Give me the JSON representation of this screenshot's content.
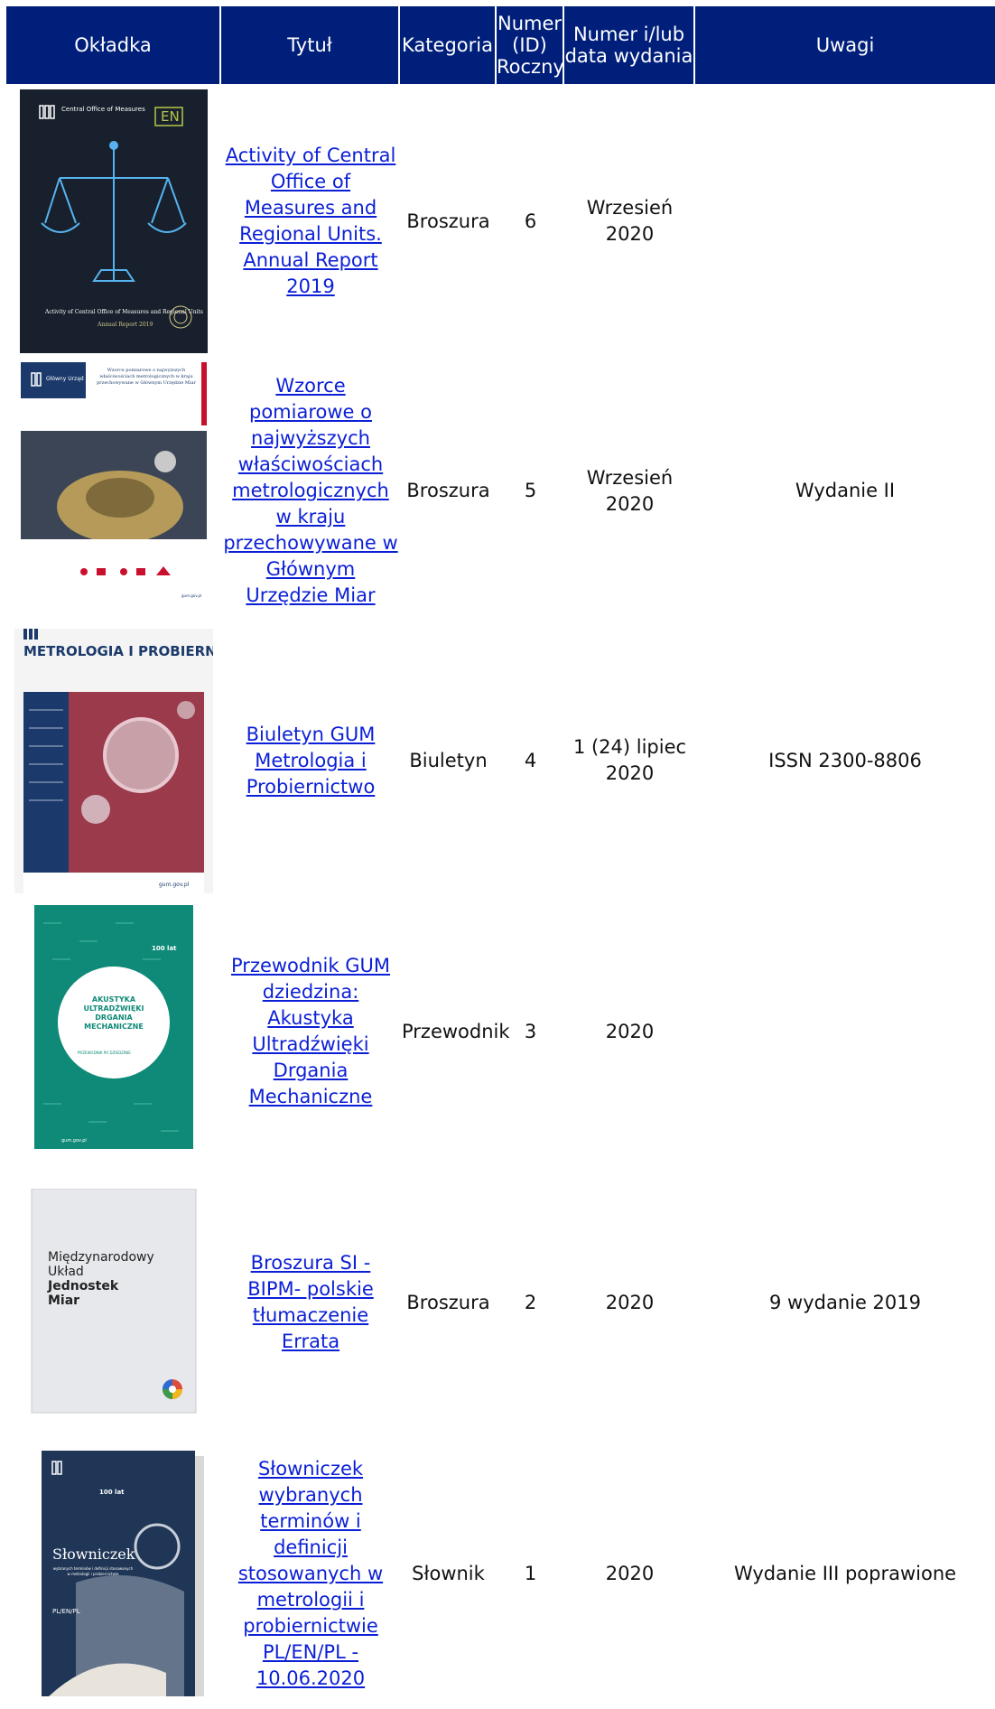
{
  "table": {
    "headers": {
      "cover": "Okładka",
      "title": "Tytuł",
      "category": "Kategoria",
      "number_yearly": "Numer (ID) Roczny",
      "issue_date": "Numer i/lub data wydania",
      "notes": "Uwagi"
    },
    "rows": [
      {
        "title": "Activity of Central Office of Measures and Regional Units. Annual Report 2019",
        "category": "Broszura",
        "number": "6",
        "date": "Wrzesień 2020",
        "notes": "",
        "cover": {
          "logo": "Central Office of Measures",
          "lang": "EN",
          "caption": "Activity of Central Office of Measures and Regional Units",
          "subcaption": "Annual Report 2019"
        }
      },
      {
        "title": "Wzorce pomiarowe o najwyższych właściwościach metrologicznych w kraju przechowywane w Głównym Urzędzie Miar",
        "category": "Broszura",
        "number": "5",
        "date": "Wrzesień 2020",
        "notes": "Wydanie II",
        "cover": {
          "logo": "Główny Urząd Miar",
          "caption": "Wzorce pomiarowe o najwyższych właściwościach metrologicznych w kraju przechowywane w Głównym Urzędzie Miar",
          "footer": "gum.gov.pl"
        }
      },
      {
        "title": "Biuletyn GUM Metrologia i Probiernictwo",
        "category": "Biuletyn",
        "number": "4",
        "date": "1 (24) lipiec 2020",
        "notes": "ISSN 2300-8806",
        "cover": {
          "masthead": "METROLOGIA I PROBIERNICTWO",
          "footer": "gum.gov.pl"
        }
      },
      {
        "title": "Przewodnik GUM dziedzina: Akustyka Ultradźwięki Drgania Mechaniczne",
        "category": "Przewodnik",
        "number": "3",
        "date": "2020",
        "notes": "",
        "cover": {
          "caption": "AKUSTYKA ULTRADŹWIĘKI DRGANIA MECHANICZNE",
          "subcaption": "PRZEWODNIK PO DZIEDZINIE",
          "badge": "100 lat",
          "footer": "gum.gov.pl"
        }
      },
      {
        "title": "Broszura SI - BIPM- polskie tłumaczenie Errata",
        "category": "Broszura",
        "number": "2",
        "date": "2020",
        "notes": "9 wydanie 2019",
        "cover": {
          "caption_line1": "Międzynarodowy",
          "caption_line2": "Układ",
          "caption_line3": "Jednostek",
          "caption_line4": "Miar"
        }
      },
      {
        "title": "Słowniczek wybranych terminów i definicji stosowanych w metrologii i probiernictwie PL/EN/PL - 10.06.2020",
        "category": "Słownik",
        "number": "1",
        "date": "2020",
        "notes": "Wydanie III poprawione",
        "cover": {
          "caption": "Słowniczek",
          "subcaption": "wybranych terminów i definicji stosowanych w metrologii i probiernictwie",
          "lang": "PL/EN/PL",
          "badge": "100 lat"
        }
      }
    ]
  },
  "colors": {
    "header_bg": "#001f7a",
    "header_text": "#ffffff",
    "link": "#0b1fd6"
  }
}
